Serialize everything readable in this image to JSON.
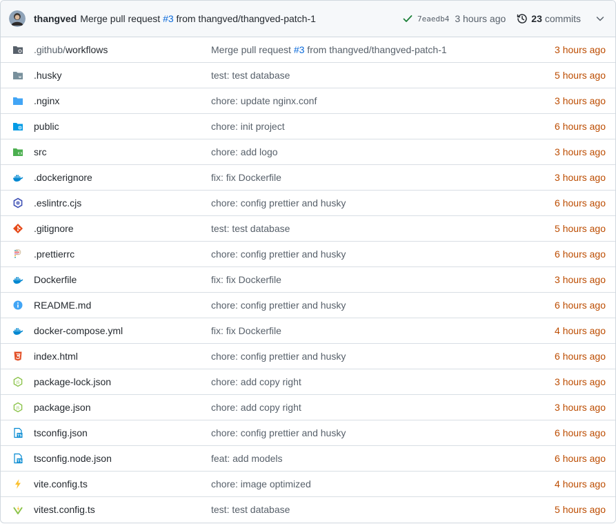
{
  "header": {
    "author": "thangved",
    "message_prefix": "Merge pull request ",
    "message_pr": "#3",
    "message_suffix": " from thangved/thangved-patch-1",
    "sha": "7eaedb4",
    "time": "3 hours ago",
    "commit_count": "23",
    "commit_label": "commits"
  },
  "colors": {
    "folder_gray": "#57606a",
    "folder_blue": "#42a5f5",
    "folder_green": "#4caf50",
    "docker": "#0288d1",
    "git": "#e64a19",
    "html": "#e34f26",
    "node": "#8bc34a",
    "ts": "#0288d1",
    "vite": "#fbc02d",
    "time": "#bc4c00",
    "link": "#0969da"
  },
  "files": [
    {
      "name_dim": ".github/",
      "name": "workflows",
      "icon": "github-folder-icon",
      "msg_prefix": "Merge pull request ",
      "msg_pr": "#3",
      "msg_suffix": " from thangved/thangved-patch-1",
      "time": "3 hours ago"
    },
    {
      "name_dim": "",
      "name": ".husky",
      "icon": "husky-folder-icon",
      "msg_prefix": "test: test database",
      "msg_pr": "",
      "msg_suffix": "",
      "time": "5 hours ago"
    },
    {
      "name_dim": "",
      "name": ".nginx",
      "icon": "folder-icon",
      "msg_prefix": "chore: update nginx.conf",
      "msg_pr": "",
      "msg_suffix": "",
      "time": "3 hours ago"
    },
    {
      "name_dim": "",
      "name": "public",
      "icon": "public-folder-icon",
      "msg_prefix": "chore: init project",
      "msg_pr": "",
      "msg_suffix": "",
      "time": "6 hours ago"
    },
    {
      "name_dim": "",
      "name": "src",
      "icon": "src-folder-icon",
      "msg_prefix": "chore: add logo",
      "msg_pr": "",
      "msg_suffix": "",
      "time": "3 hours ago"
    },
    {
      "name_dim": "",
      "name": ".dockerignore",
      "icon": "docker-icon",
      "msg_prefix": "fix: fix Dockerfile",
      "msg_pr": "",
      "msg_suffix": "",
      "time": "3 hours ago"
    },
    {
      "name_dim": "",
      "name": ".eslintrc.cjs",
      "icon": "eslint-icon",
      "msg_prefix": "chore: config prettier and husky",
      "msg_pr": "",
      "msg_suffix": "",
      "time": "6 hours ago"
    },
    {
      "name_dim": "",
      "name": ".gitignore",
      "icon": "git-icon",
      "msg_prefix": "test: test database",
      "msg_pr": "",
      "msg_suffix": "",
      "time": "5 hours ago"
    },
    {
      "name_dim": "",
      "name": ".prettierrc",
      "icon": "prettier-icon",
      "msg_prefix": "chore: config prettier and husky",
      "msg_pr": "",
      "msg_suffix": "",
      "time": "6 hours ago"
    },
    {
      "name_dim": "",
      "name": "Dockerfile",
      "icon": "docker-icon",
      "msg_prefix": "fix: fix Dockerfile",
      "msg_pr": "",
      "msg_suffix": "",
      "time": "3 hours ago"
    },
    {
      "name_dim": "",
      "name": "README.md",
      "icon": "info-icon",
      "msg_prefix": "chore: config prettier and husky",
      "msg_pr": "",
      "msg_suffix": "",
      "time": "6 hours ago"
    },
    {
      "name_dim": "",
      "name": "docker-compose.yml",
      "icon": "docker-icon",
      "msg_prefix": "fix: fix Dockerfile",
      "msg_pr": "",
      "msg_suffix": "",
      "time": "4 hours ago"
    },
    {
      "name_dim": "",
      "name": "index.html",
      "icon": "html-icon",
      "msg_prefix": "chore: config prettier and husky",
      "msg_pr": "",
      "msg_suffix": "",
      "time": "6 hours ago"
    },
    {
      "name_dim": "",
      "name": "package-lock.json",
      "icon": "nodejs-icon",
      "msg_prefix": "chore: add copy right",
      "msg_pr": "",
      "msg_suffix": "",
      "time": "3 hours ago"
    },
    {
      "name_dim": "",
      "name": "package.json",
      "icon": "nodejs-icon",
      "msg_prefix": "chore: add copy right",
      "msg_pr": "",
      "msg_suffix": "",
      "time": "3 hours ago"
    },
    {
      "name_dim": "",
      "name": "tsconfig.json",
      "icon": "tsconfig-icon",
      "msg_prefix": "chore: config prettier and husky",
      "msg_pr": "",
      "msg_suffix": "",
      "time": "6 hours ago"
    },
    {
      "name_dim": "",
      "name": "tsconfig.node.json",
      "icon": "tsconfig-icon",
      "msg_prefix": "feat: add models",
      "msg_pr": "",
      "msg_suffix": "",
      "time": "6 hours ago"
    },
    {
      "name_dim": "",
      "name": "vite.config.ts",
      "icon": "vite-icon",
      "msg_prefix": "chore: image optimized",
      "msg_pr": "",
      "msg_suffix": "",
      "time": "4 hours ago"
    },
    {
      "name_dim": "",
      "name": "vitest.config.ts",
      "icon": "vitest-icon",
      "msg_prefix": "test: test database",
      "msg_pr": "",
      "msg_suffix": "",
      "time": "5 hours ago"
    }
  ]
}
